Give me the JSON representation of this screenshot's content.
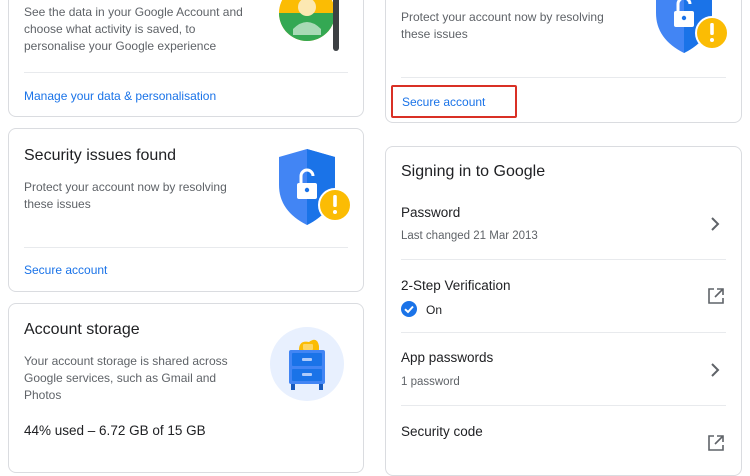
{
  "data_card": {
    "description": "See the data in your Google Account and choose what activity is saved, to personalise your Google experience",
    "link": "Manage your data & personalisation"
  },
  "security_card_left": {
    "title": "Security issues found",
    "description": "Protect your account now by resolving these issues",
    "link": "Secure account"
  },
  "storage_card": {
    "title": "Account storage",
    "description": "Your account storage is shared across Google services, such as Gmail and Photos",
    "usage": "44% used – 6.72 GB of 15 GB"
  },
  "security_card_right": {
    "description": "Protect your account now by resolving these issues",
    "link": "Secure account"
  },
  "signing_in": {
    "title": "Signing in to Google",
    "rows": [
      {
        "title": "Password",
        "sub": "Last changed 21 Mar 2013",
        "action_icon": "chevron-right-icon"
      },
      {
        "title": "2-Step Verification",
        "sub": "On",
        "status_icon": "check-circle-icon",
        "action_icon": "open-external-icon"
      },
      {
        "title": "App passwords",
        "sub": "1 password",
        "action_icon": "chevron-right-icon"
      },
      {
        "title": "Security code",
        "sub": "",
        "action_icon": "open-external-icon"
      }
    ]
  },
  "colors": {
    "accent_blue": "#1a73e8",
    "shield_blue": "#4285f4",
    "warning_yellow": "#fbbc04",
    "highlight_red": "#d93025",
    "border": "#dadce0"
  }
}
